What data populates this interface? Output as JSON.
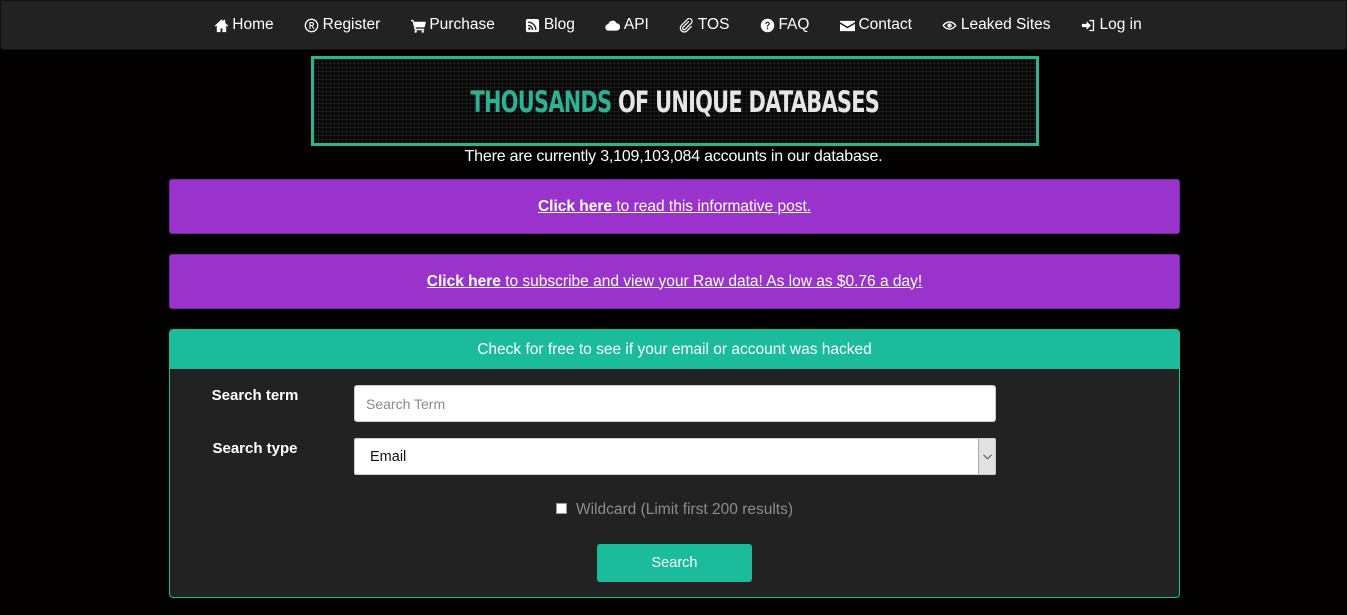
{
  "nav": {
    "items": [
      {
        "label": "Home",
        "icon": "home-icon"
      },
      {
        "label": "Register",
        "icon": "registered-icon"
      },
      {
        "label": "Purchase",
        "icon": "cart-icon"
      },
      {
        "label": "Blog",
        "icon": "rss-icon"
      },
      {
        "label": "API",
        "icon": "cloud-icon"
      },
      {
        "label": "TOS",
        "icon": "paperclip-icon"
      },
      {
        "label": "FAQ",
        "icon": "question-circle-icon"
      },
      {
        "label": "Contact",
        "icon": "envelope-icon"
      },
      {
        "label": "Leaked Sites",
        "icon": "eye-icon"
      },
      {
        "label": "Log in",
        "icon": "sign-in-icon"
      }
    ]
  },
  "banner": {
    "accent_text": "THOUSANDS",
    "rest_text": " OF UNIQUE DATABASES",
    "accent_color": "#2bb394"
  },
  "stats": {
    "account_count_text": "There are currently 3,109,103,084 accounts in our database."
  },
  "promos": [
    {
      "link_bold": "Click here",
      "link_rest": " to read this informative post."
    },
    {
      "link_bold": "Click here",
      "link_rest": " to subscribe and view your Raw data! As low as $0.76 a day!"
    }
  ],
  "search_panel": {
    "heading": "Check for free to see if your email or account was hacked",
    "search_term_label": "Search term",
    "search_term_value": "",
    "search_term_placeholder": "Search Term",
    "search_type_label": "Search type",
    "search_type_selected": "Email",
    "wildcard_label": "Wildcard (Limit first 200 results)",
    "wildcard_checked": false,
    "search_button_label": "Search"
  },
  "colors": {
    "nav_bg": "#222222",
    "promo_bg": "#9933cc",
    "accent": "#1abc9c",
    "panel_bg": "#222222"
  }
}
